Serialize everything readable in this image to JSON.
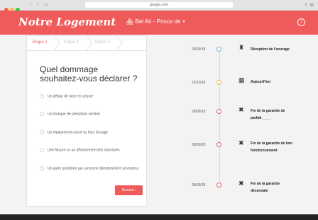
{
  "browser": {
    "url": "google.com",
    "colors": {
      "close": "#ff5f57",
      "min": "#febc2e",
      "max": "#28c840"
    }
  },
  "app": {
    "brand": "Notre Logement",
    "location": "Bel Air - Prince de",
    "location_icon": "home-group-icon",
    "info_icon": "info-icon",
    "accent": "#ef5a5a"
  },
  "steps": [
    "Etape 1",
    "Etape 2",
    "Etape 3"
  ],
  "form": {
    "question": "Quel dommage souhaitez-vous déclarer ?",
    "options": [
      "Un défaut de mise en oeuvre",
      "Un manque de prestation vendue",
      "Un équipement cassé ou hors d'usage",
      "Une fissure ou un affaissement des structures",
      "Un autre problème qui concerne directement le promoteur"
    ],
    "next_label": "Suivant ›"
  },
  "timeline": [
    {
      "date": "28/09/18",
      "label": "Réception de l'ouvrage",
      "icon": "building-icon",
      "circle": "#6fb3d9"
    },
    {
      "date": "16/10/18",
      "label": "Aujourd'hui",
      "icon": "calendar-icon",
      "circle": "#f0b445"
    },
    {
      "date": "28/09/19",
      "label": "Fin de la garantie de parfait ____",
      "icon": "close-x-icon",
      "circle": "#e55a5a"
    },
    {
      "date": "28/09/20",
      "label": "Fin de la garantie de bon fonctionnement",
      "icon": "close-x-icon",
      "circle": "#e55a5a"
    },
    {
      "date": "28/09/28",
      "label": "Fin de la garantie décennale",
      "icon": "close-x-icon",
      "circle": "#e55a5a"
    }
  ]
}
